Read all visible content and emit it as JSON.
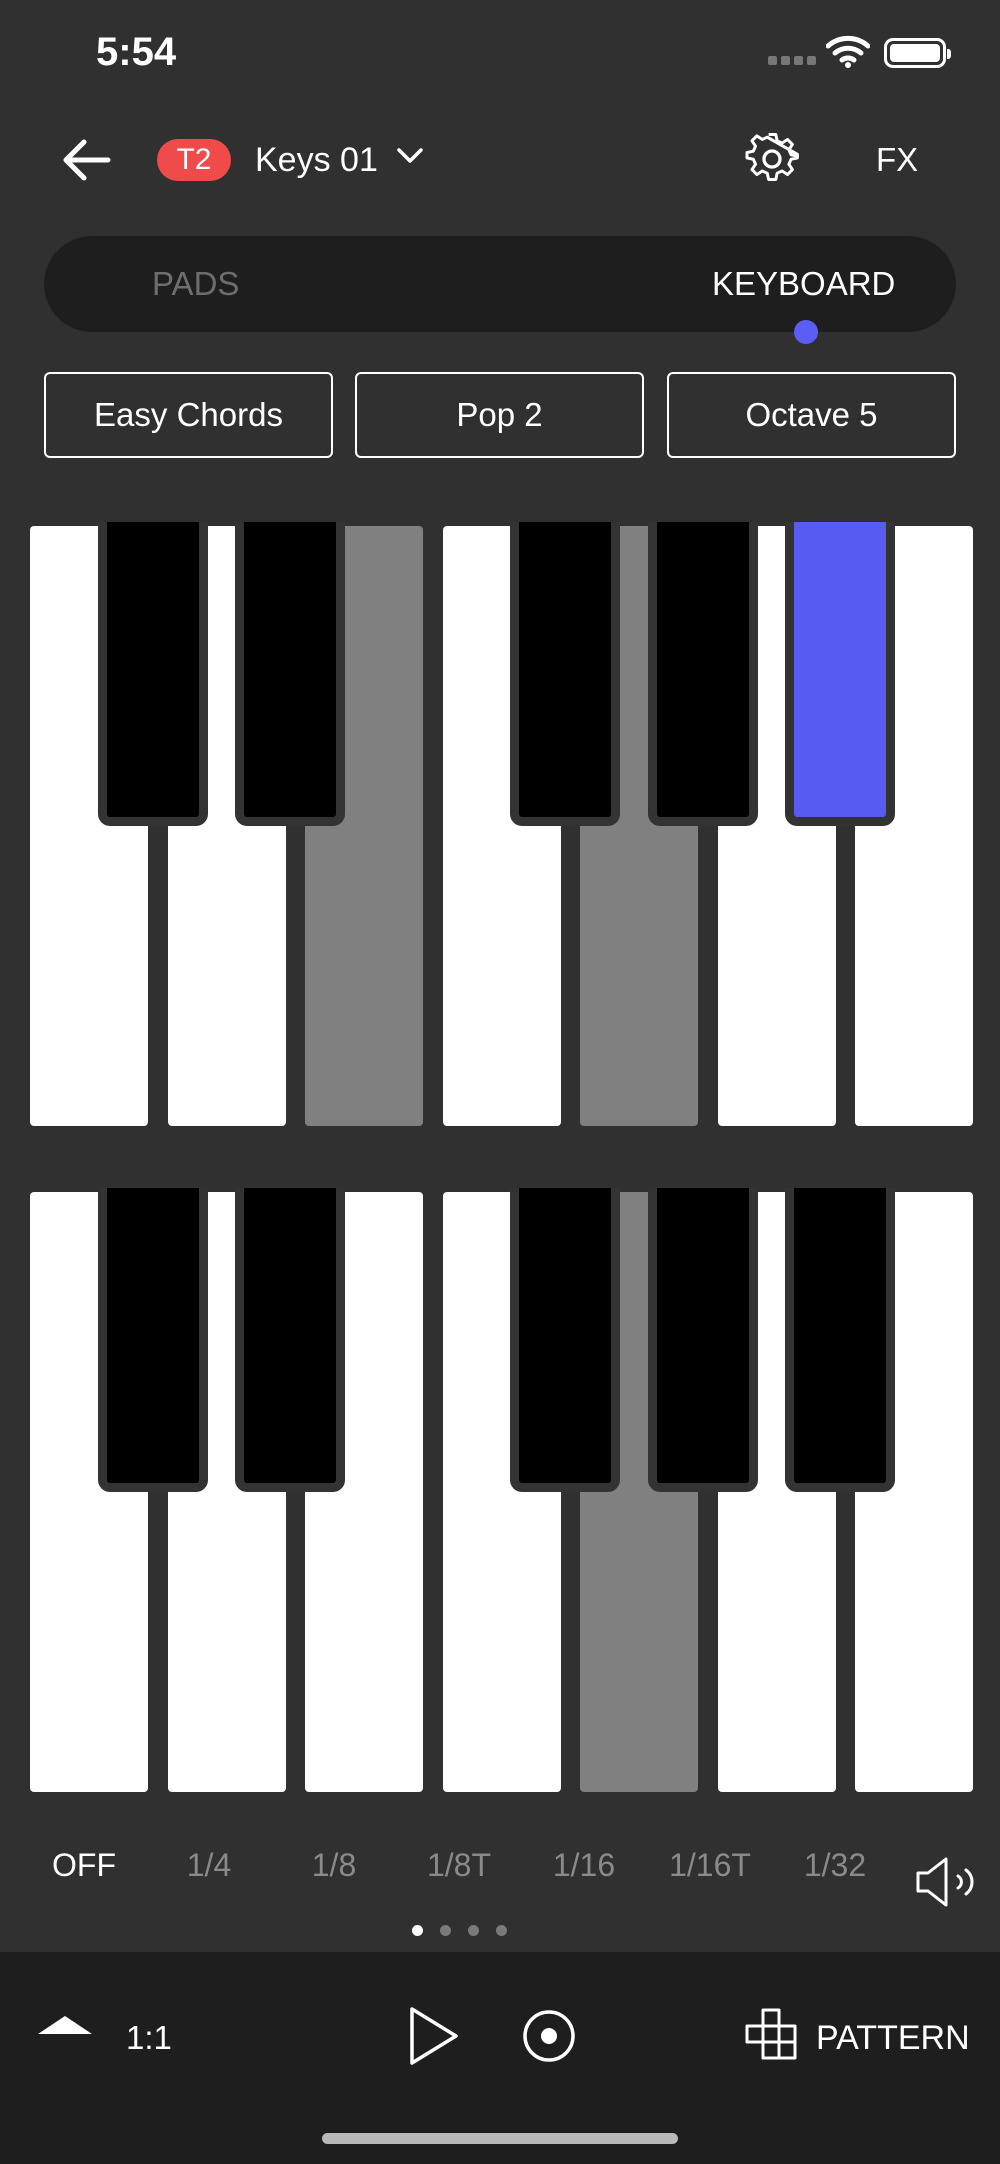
{
  "status": {
    "time": "5:54"
  },
  "header": {
    "track": "T2",
    "instrument": "Keys 01",
    "fx_label": "FX"
  },
  "mode_tabs": {
    "pads": "PADS",
    "keyboard": "KEYBOARD",
    "selected": "KEYBOARD"
  },
  "options": {
    "mode": "Easy Chords",
    "chord_set": "Pop 2",
    "octave": "Octave 5"
  },
  "keyboards": [
    {
      "highlighted_white_keys": [
        2,
        4
      ],
      "active_black_key": 4
    },
    {
      "highlighted_white_keys": [
        4
      ],
      "active_black_key": null
    }
  ],
  "note_repeat": {
    "options": [
      "OFF",
      "1/4",
      "1/8",
      "1/8T",
      "1/16",
      "1/16T",
      "1/32"
    ],
    "selected": "OFF"
  },
  "pager": {
    "pages": 4,
    "current": 1
  },
  "transport": {
    "position": "1:1",
    "pattern_label": "PATTERN"
  },
  "colors": {
    "background": "#303030",
    "panel": "#1e1e1e",
    "accent": "#575bf0",
    "track_badge": "#f04a4a",
    "highlighted_key": "#808080"
  }
}
